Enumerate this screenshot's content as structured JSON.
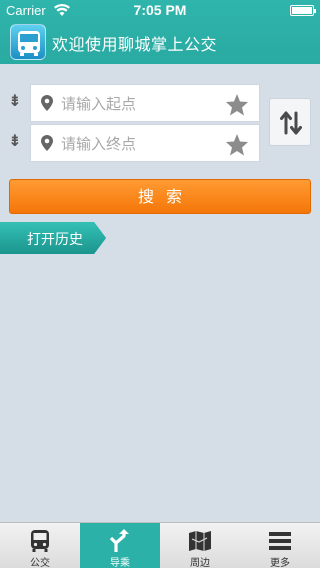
{
  "status_bar": {
    "carrier": "Carrier",
    "time": "7:05 PM"
  },
  "header": {
    "title": "欢迎使用聊城掌上公交"
  },
  "form": {
    "start_placeholder": "请输入起点",
    "end_placeholder": "请输入终点",
    "search_label": "搜索",
    "history_label": "打开历史"
  },
  "tabs": [
    {
      "label": "公交",
      "icon": "bus-icon"
    },
    {
      "label": "导乘",
      "icon": "route-arrow-icon"
    },
    {
      "label": "周边",
      "icon": "map-icon"
    },
    {
      "label": "更多",
      "icon": "menu-icon"
    }
  ],
  "colors": {
    "accent": "#2bb1a8",
    "search": "#f57608",
    "background": "#d5dde6"
  }
}
